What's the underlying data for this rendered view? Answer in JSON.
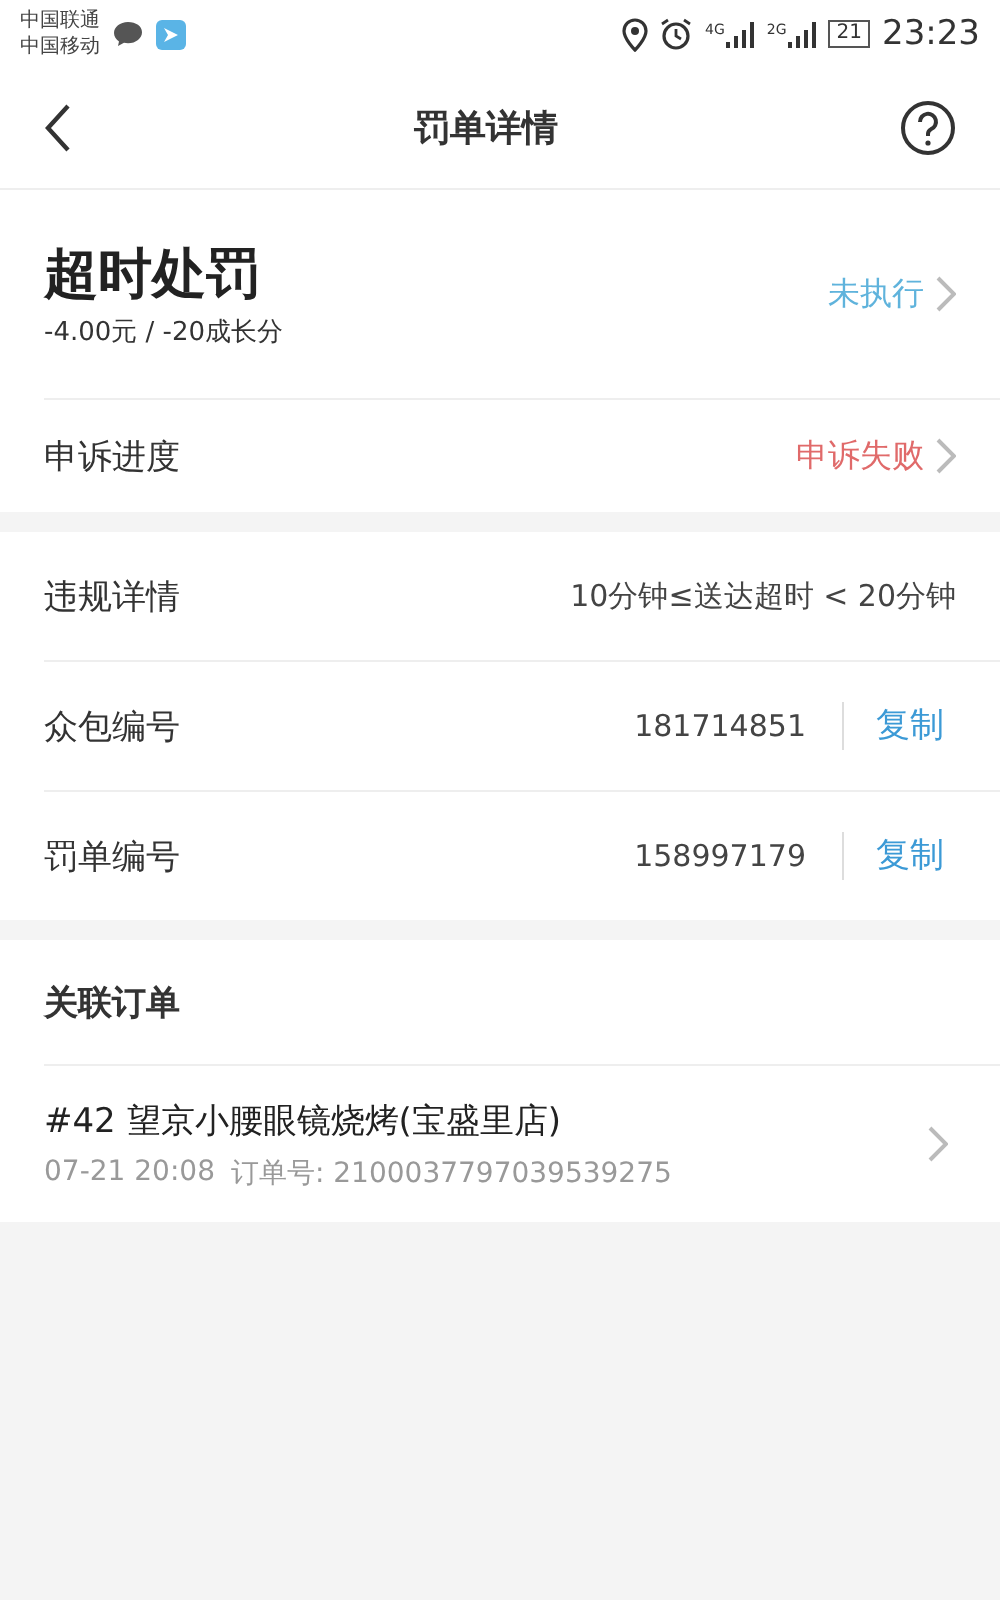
{
  "status_bar": {
    "carriers": [
      "中国联通",
      "中国移动"
    ],
    "signals": [
      "4G",
      "2G"
    ],
    "battery": "21",
    "time": "23:23"
  },
  "nav": {
    "title": "罚单详情"
  },
  "penalty": {
    "title": "超时处罚",
    "amount": "-4.00元 / -20成长分",
    "status": "未执行"
  },
  "appeal": {
    "label": "申诉进度",
    "status": "申诉失败"
  },
  "details": [
    {
      "kind": "text",
      "label": "违规详情",
      "value": "10分钟≤送达超时 < 20分钟"
    },
    {
      "kind": "copy",
      "label": "众包编号",
      "value": "181714851",
      "action": "复制"
    },
    {
      "kind": "copy",
      "label": "罚单编号",
      "value": "158997179",
      "action": "复制"
    }
  ],
  "related": {
    "heading": "关联订单",
    "orders": [
      {
        "title": "#42 望京小腰眼镜烧烤(宝盛里店)",
        "time": "07-21 20:08",
        "order_no": "订单号: 2100037797039539275"
      }
    ]
  }
}
